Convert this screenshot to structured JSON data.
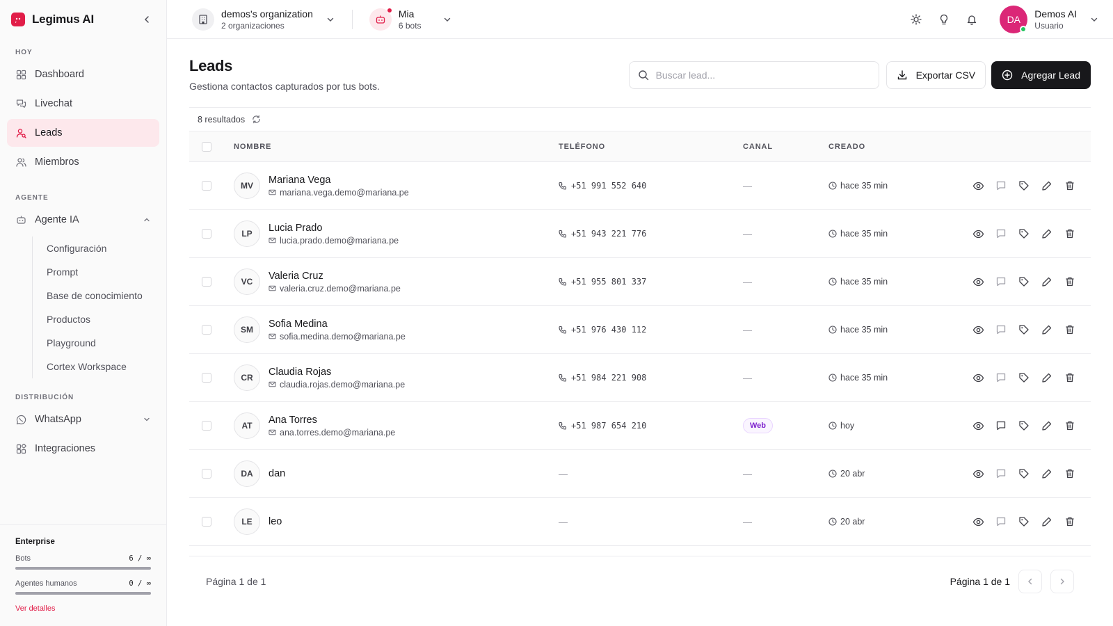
{
  "brand": {
    "name": "Legimus AI",
    "accent": "#e11d48"
  },
  "sidebar": {
    "sections": {
      "hoy": "HOY",
      "agente": "AGENTE",
      "distribucion": "DISTRIBUCIÓN"
    },
    "items": {
      "dashboard": "Dashboard",
      "livechat": "Livechat",
      "leads": "Leads",
      "miembros": "Miembros",
      "agente_ia": "Agente IA",
      "whatsapp": "WhatsApp",
      "integraciones": "Integraciones"
    },
    "agente_sub": [
      "Configuración",
      "Prompt",
      "Base de conocimiento",
      "Productos",
      "Playground",
      "Cortex Workspace"
    ],
    "plan": {
      "name": "Enterprise",
      "bots_label": "Bots",
      "bots_value": "6 / ∞",
      "bots_fill": 1.0,
      "humans_label": "Agentes humanos",
      "humans_value": "0 / ∞",
      "humans_fill": 1.0,
      "details_link": "Ver detalles"
    }
  },
  "topbar": {
    "org_title": "demos's organization",
    "org_sub": "2 organizaciones",
    "bot_title": "Mia",
    "bot_sub": "6 bots",
    "user_initials": "DA",
    "user_name": "Demos AI",
    "user_role": "Usuario",
    "icons": [
      "sun-icon",
      "lightbulb-icon",
      "bell-icon"
    ]
  },
  "page": {
    "title": "Leads",
    "subtitle": "Gestiona contactos capturados por tus bots.",
    "search_placeholder": "Buscar lead...",
    "export_label": "Exportar CSV",
    "add_label": "Agregar Lead",
    "results": "8 resultados"
  },
  "table": {
    "headers": {
      "name": "NOMBRE",
      "phone": "TELÉFONO",
      "channel": "CANAL",
      "created": "CREADO"
    },
    "rows": [
      {
        "initials": "MV",
        "name": "Mariana Vega",
        "email": "mariana.vega.demo@mariana.pe",
        "phone": "+51 991 552 640",
        "channel": "—",
        "created": "hace 35 min"
      },
      {
        "initials": "LP",
        "name": "Lucia Prado",
        "email": "lucia.prado.demo@mariana.pe",
        "phone": "+51 943 221 776",
        "channel": "—",
        "created": "hace 35 min"
      },
      {
        "initials": "VC",
        "name": "Valeria Cruz",
        "email": "valeria.cruz.demo@mariana.pe",
        "phone": "+51 955 801 337",
        "channel": "—",
        "created": "hace 35 min"
      },
      {
        "initials": "SM",
        "name": "Sofia Medina",
        "email": "sofia.medina.demo@mariana.pe",
        "phone": "+51 976 430 112",
        "channel": "—",
        "created": "hace 35 min"
      },
      {
        "initials": "CR",
        "name": "Claudia Rojas",
        "email": "claudia.rojas.demo@mariana.pe",
        "phone": "+51 984 221 908",
        "channel": "—",
        "created": "hace 35 min"
      },
      {
        "initials": "AT",
        "name": "Ana Torres",
        "email": "ana.torres.demo@mariana.pe",
        "phone": "+51 987 654 210",
        "channel": "Web",
        "created": "hoy"
      },
      {
        "initials": "DA",
        "name": "dan",
        "email": "",
        "phone": "—",
        "channel": "—",
        "created": "20 abr"
      },
      {
        "initials": "LE",
        "name": "leo",
        "email": "",
        "phone": "—",
        "channel": "—",
        "created": "20 abr"
      }
    ],
    "row_actions": [
      "eye-icon",
      "message-icon",
      "tag-icon",
      "pencil-icon",
      "trash-icon"
    ]
  },
  "pagination": {
    "left": "Página 1 de 1",
    "right": "Página 1 de 1"
  }
}
